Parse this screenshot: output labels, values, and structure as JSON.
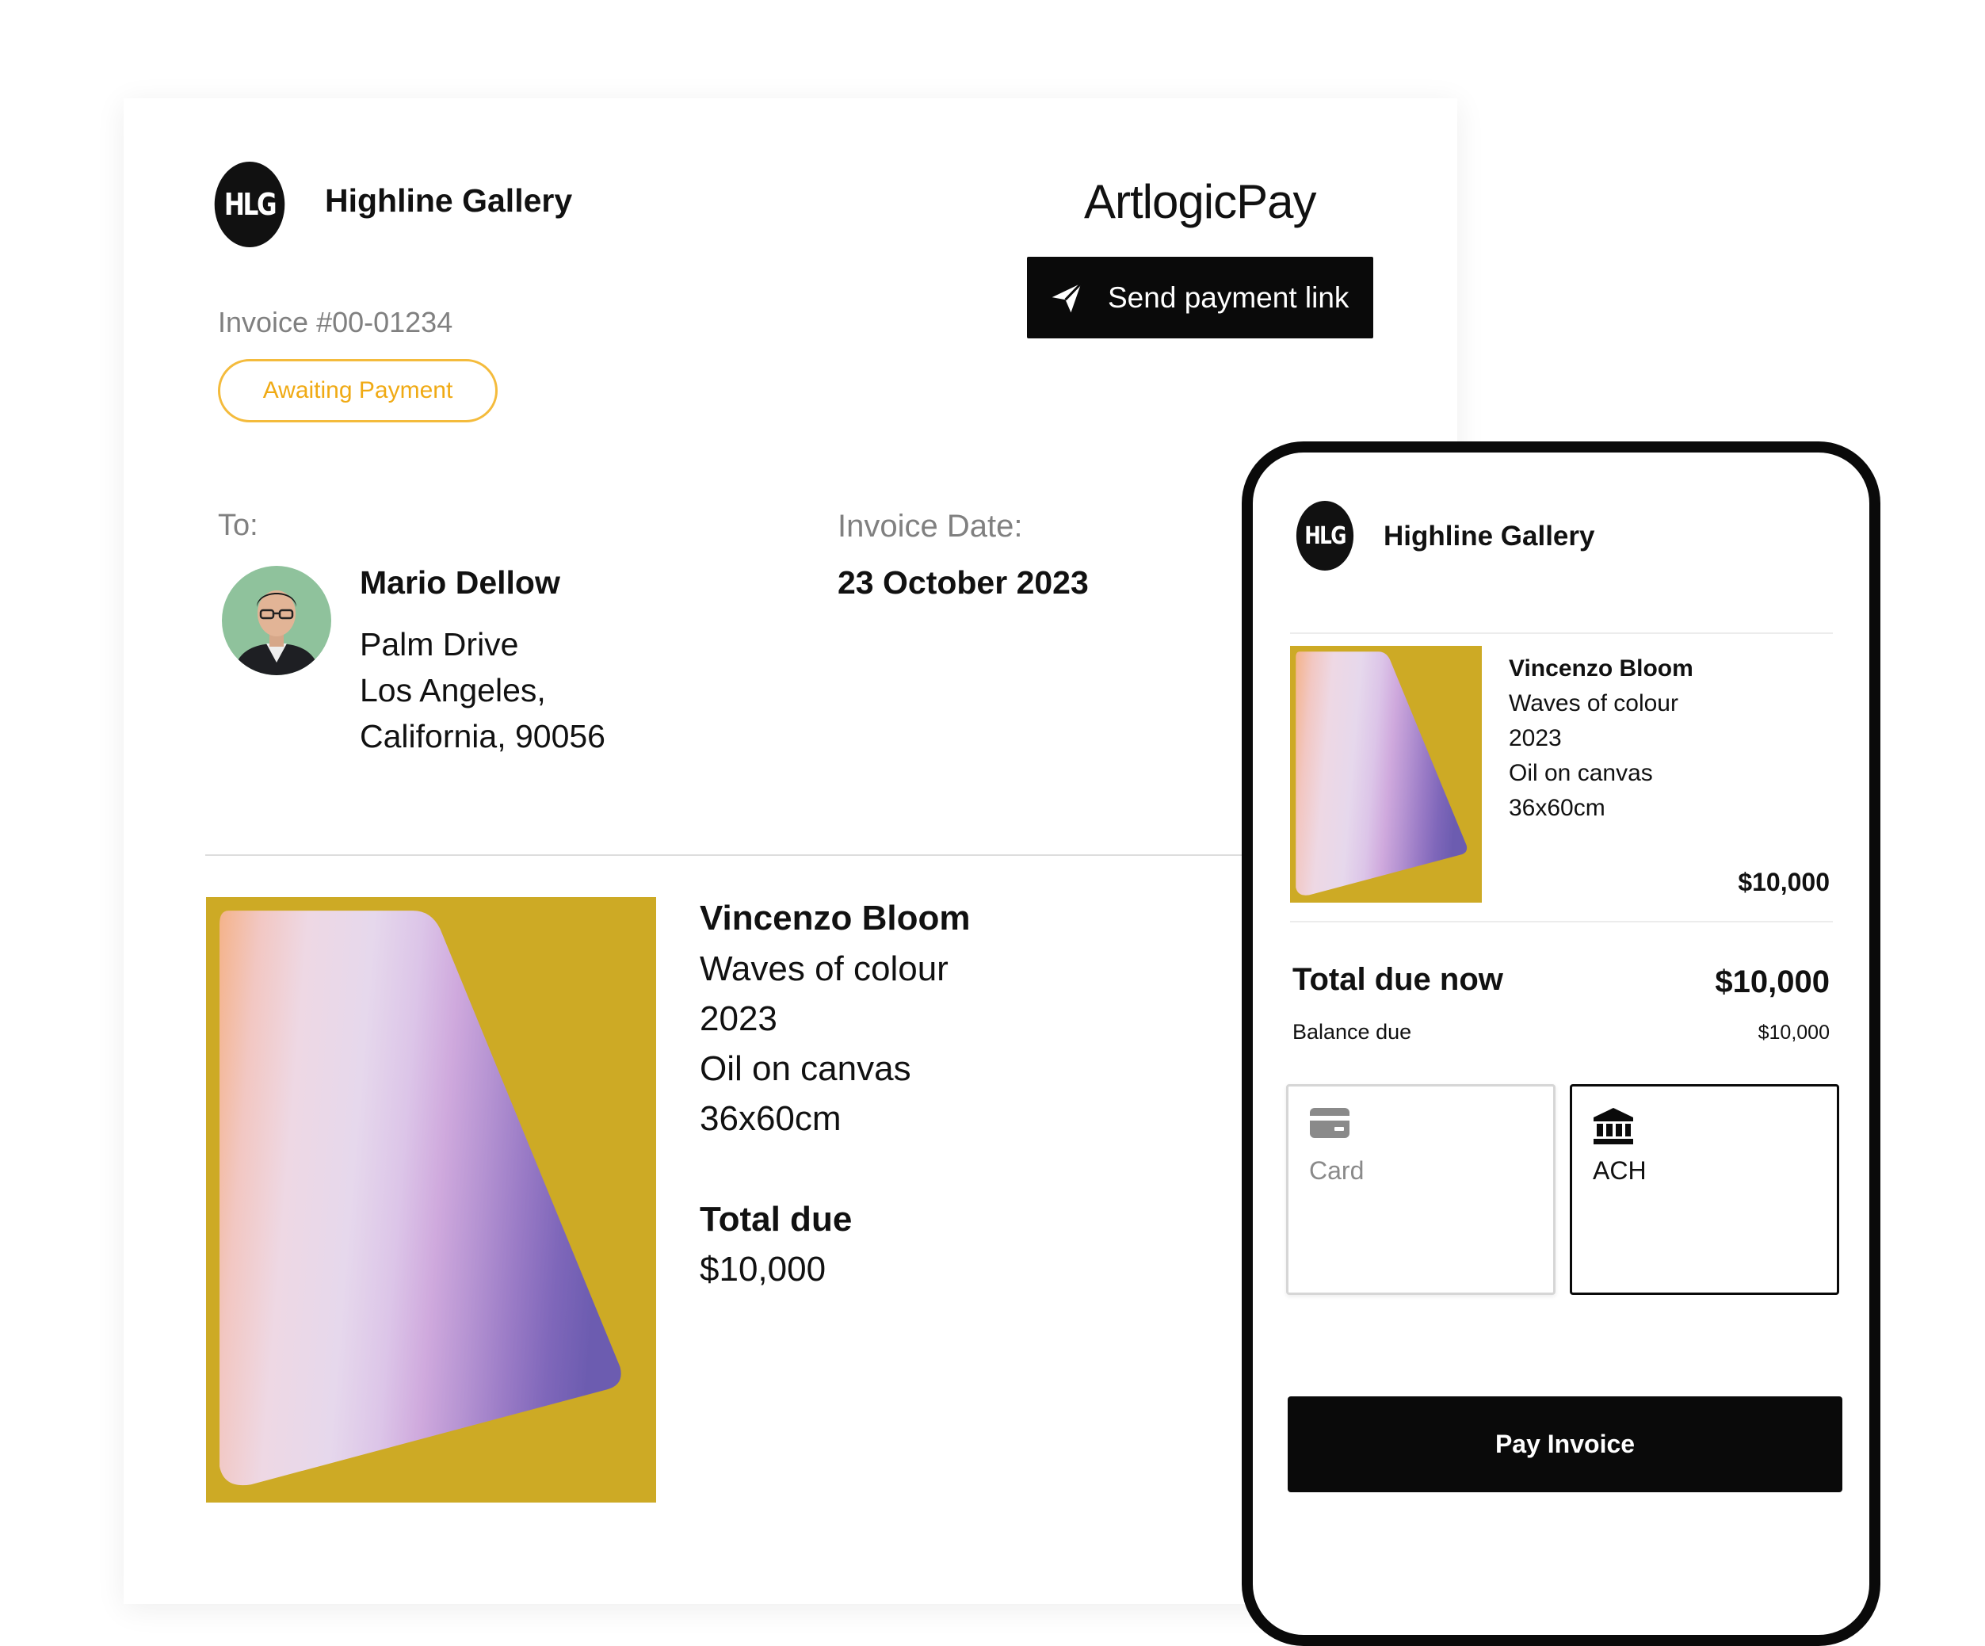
{
  "invoice": {
    "gallery_initials": "HLG",
    "gallery_name": "Highline Gallery",
    "brand": "ArtlogicPay",
    "send_link_label": "Send payment link",
    "number": "Invoice #00-01234",
    "status": "Awaiting Payment",
    "to_label": "To:",
    "customer": {
      "name": "Mario Dellow",
      "address_line1": "Palm Drive",
      "address_line2": "Los Angeles,",
      "address_line3": "California, 90056"
    },
    "date_label": "Invoice Date:",
    "date_value": "23 October 2023",
    "artwork": {
      "artist": "Vincenzo Bloom",
      "title": "Waves of colour",
      "year": "2023",
      "medium": "Oil on canvas",
      "dimensions": "36x60cm"
    },
    "total_label": "Total due",
    "total_value": "$10,000"
  },
  "phone": {
    "gallery_initials": "HLG",
    "gallery_name": "Highline Gallery",
    "artwork": {
      "artist": "Vincenzo Bloom",
      "title": "Waves of colour",
      "year": "2023",
      "medium": "Oil on canvas",
      "dimensions": "36x60cm",
      "price": "$10,000"
    },
    "total_label": "Total due now",
    "total_value": "$10,000",
    "balance_label": "Balance due",
    "balance_value": "$10,000",
    "payment_options": [
      {
        "label": "Card",
        "icon": "credit-card-icon",
        "selected": false
      },
      {
        "label": "ACH",
        "icon": "bank-icon",
        "selected": true
      }
    ],
    "pay_button_label": "Pay Invoice"
  },
  "colors": {
    "status_accent": "#f0aa14",
    "button_bg": "#0a0a0a",
    "artwork_ground": "#cdaa25"
  }
}
